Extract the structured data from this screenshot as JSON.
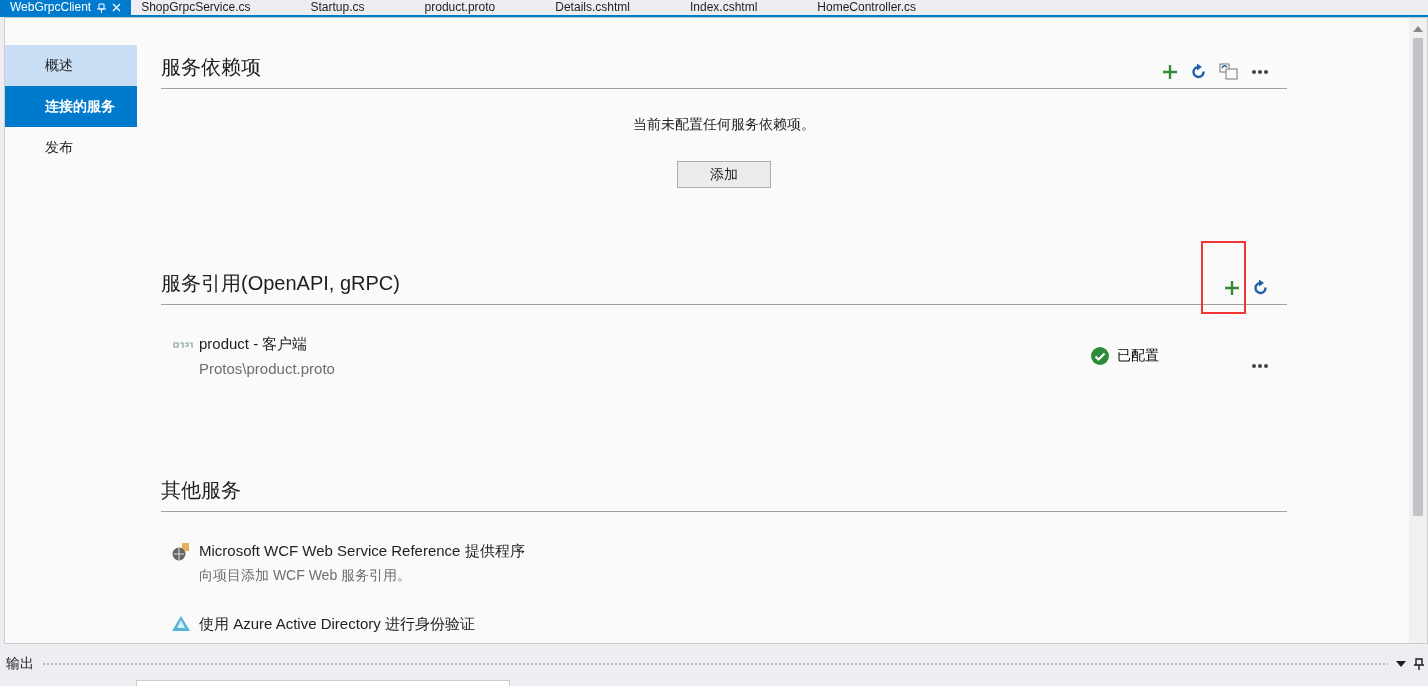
{
  "tabs": [
    {
      "label": "WebGrpcClient",
      "selected": true
    },
    {
      "label": "ShopGrpcService.cs",
      "selected": false
    },
    {
      "label": "Startup.cs",
      "selected": false
    },
    {
      "label": "product.proto",
      "selected": false
    },
    {
      "label": "Details.cshtml",
      "selected": false
    },
    {
      "label": "Index.cshtml",
      "selected": false
    },
    {
      "label": "HomeController.cs",
      "selected": false
    }
  ],
  "sidebar": {
    "items": [
      {
        "label": "概述",
        "selected": false,
        "hovered": true
      },
      {
        "label": "连接的服务",
        "selected": true,
        "hovered": false
      },
      {
        "label": "发布",
        "selected": false,
        "hovered": false
      }
    ]
  },
  "sections": [
    {
      "title": "服务依赖项",
      "actions": [
        {
          "kind": "add",
          "highlighted": false
        },
        {
          "kind": "refresh",
          "highlighted": false
        },
        {
          "kind": "restore",
          "highlighted": false
        },
        {
          "kind": "more",
          "highlighted": false
        }
      ],
      "empty_text": "当前未配置任何服务依赖项。",
      "button": "添加"
    },
    {
      "title": "服务引用(OpenAPI, gRPC)",
      "actions": [
        {
          "kind": "add",
          "highlighted": true
        },
        {
          "kind": "refresh",
          "highlighted": false
        }
      ],
      "references": [
        {
          "name": "product - 客户端",
          "path": "Protos\\product.proto",
          "status": "已配置",
          "configured": true
        }
      ]
    },
    {
      "title": "其他服务",
      "providers": [
        {
          "kind": "wcf",
          "name": "Microsoft WCF Web Service Reference 提供程序",
          "description": "向项目添加 WCF Web 服务引用。"
        },
        {
          "kind": "azure",
          "name": "使用 Azure Active Directory 进行身份验证"
        }
      ]
    }
  ],
  "output_panel": {
    "title": "输出"
  }
}
